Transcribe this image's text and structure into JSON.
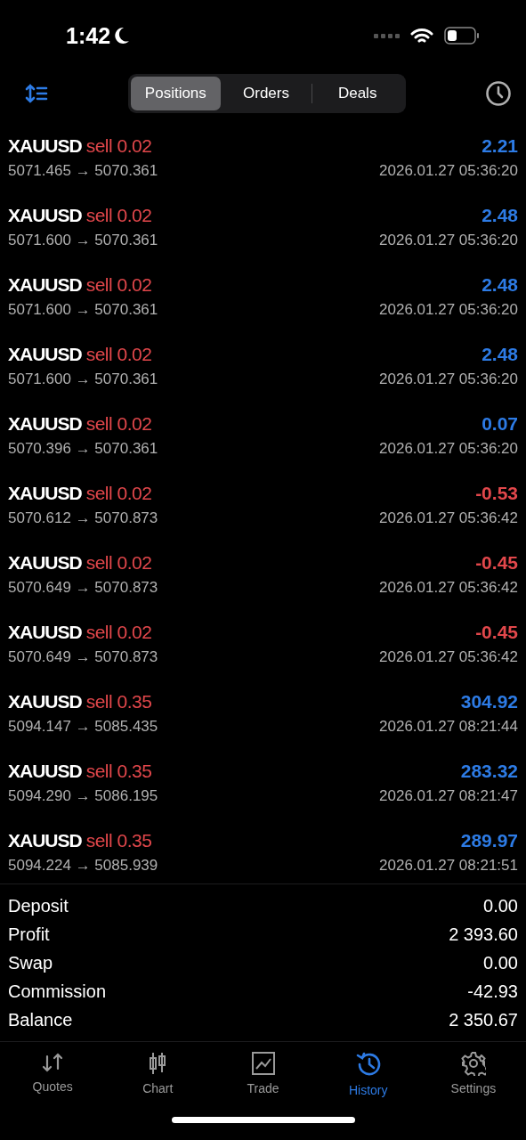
{
  "status_bar": {
    "time": "1:42"
  },
  "tabs": [
    {
      "label": "Positions",
      "selected": true
    },
    {
      "label": "Orders",
      "selected": false
    },
    {
      "label": "Deals",
      "selected": false
    }
  ],
  "deals": [
    {
      "symbol": "XAUUSD",
      "side": "sell 0.02",
      "prices": "5071.465 → 5070.361",
      "profit": "2.21",
      "kind": "gain",
      "time": "2026.01.27 05:36:20"
    },
    {
      "symbol": "XAUUSD",
      "side": "sell 0.02",
      "prices": "5071.600 → 5070.361",
      "profit": "2.48",
      "kind": "gain",
      "time": "2026.01.27 05:36:20"
    },
    {
      "symbol": "XAUUSD",
      "side": "sell 0.02",
      "prices": "5071.600 → 5070.361",
      "profit": "2.48",
      "kind": "gain",
      "time": "2026.01.27 05:36:20"
    },
    {
      "symbol": "XAUUSD",
      "side": "sell 0.02",
      "prices": "5071.600 → 5070.361",
      "profit": "2.48",
      "kind": "gain",
      "time": "2026.01.27 05:36:20"
    },
    {
      "symbol": "XAUUSD",
      "side": "sell 0.02",
      "prices": "5070.396 → 5070.361",
      "profit": "0.07",
      "kind": "gain",
      "time": "2026.01.27 05:36:20"
    },
    {
      "symbol": "XAUUSD",
      "side": "sell 0.02",
      "prices": "5070.612 → 5070.873",
      "profit": "-0.53",
      "kind": "loss",
      "time": "2026.01.27 05:36:42"
    },
    {
      "symbol": "XAUUSD",
      "side": "sell 0.02",
      "prices": "5070.649 → 5070.873",
      "profit": "-0.45",
      "kind": "loss",
      "time": "2026.01.27 05:36:42"
    },
    {
      "symbol": "XAUUSD",
      "side": "sell 0.02",
      "prices": "5070.649 → 5070.873",
      "profit": "-0.45",
      "kind": "loss",
      "time": "2026.01.27 05:36:42"
    },
    {
      "symbol": "XAUUSD",
      "side": "sell 0.35",
      "prices": "5094.147 → 5085.435",
      "profit": "304.92",
      "kind": "gain",
      "time": "2026.01.27 08:21:44"
    },
    {
      "symbol": "XAUUSD",
      "side": "sell 0.35",
      "prices": "5094.290 → 5086.195",
      "profit": "283.32",
      "kind": "gain",
      "time": "2026.01.27 08:21:47"
    },
    {
      "symbol": "XAUUSD",
      "side": "sell 0.35",
      "prices": "5094.224 → 5085.939",
      "profit": "289.97",
      "kind": "gain",
      "time": "2026.01.27 08:21:51"
    }
  ],
  "summary": [
    {
      "label": "Deposit",
      "value": "0.00"
    },
    {
      "label": "Profit",
      "value": "2 393.60"
    },
    {
      "label": "Swap",
      "value": "0.00"
    },
    {
      "label": "Commission",
      "value": "-42.93"
    },
    {
      "label": "Balance",
      "value": "2 350.67"
    }
  ],
  "bottom_nav": [
    {
      "label": "Quotes",
      "selected": false
    },
    {
      "label": "Chart",
      "selected": false
    },
    {
      "label": "Trade",
      "selected": false
    },
    {
      "label": "History",
      "selected": true
    },
    {
      "label": "Settings",
      "selected": false
    }
  ]
}
